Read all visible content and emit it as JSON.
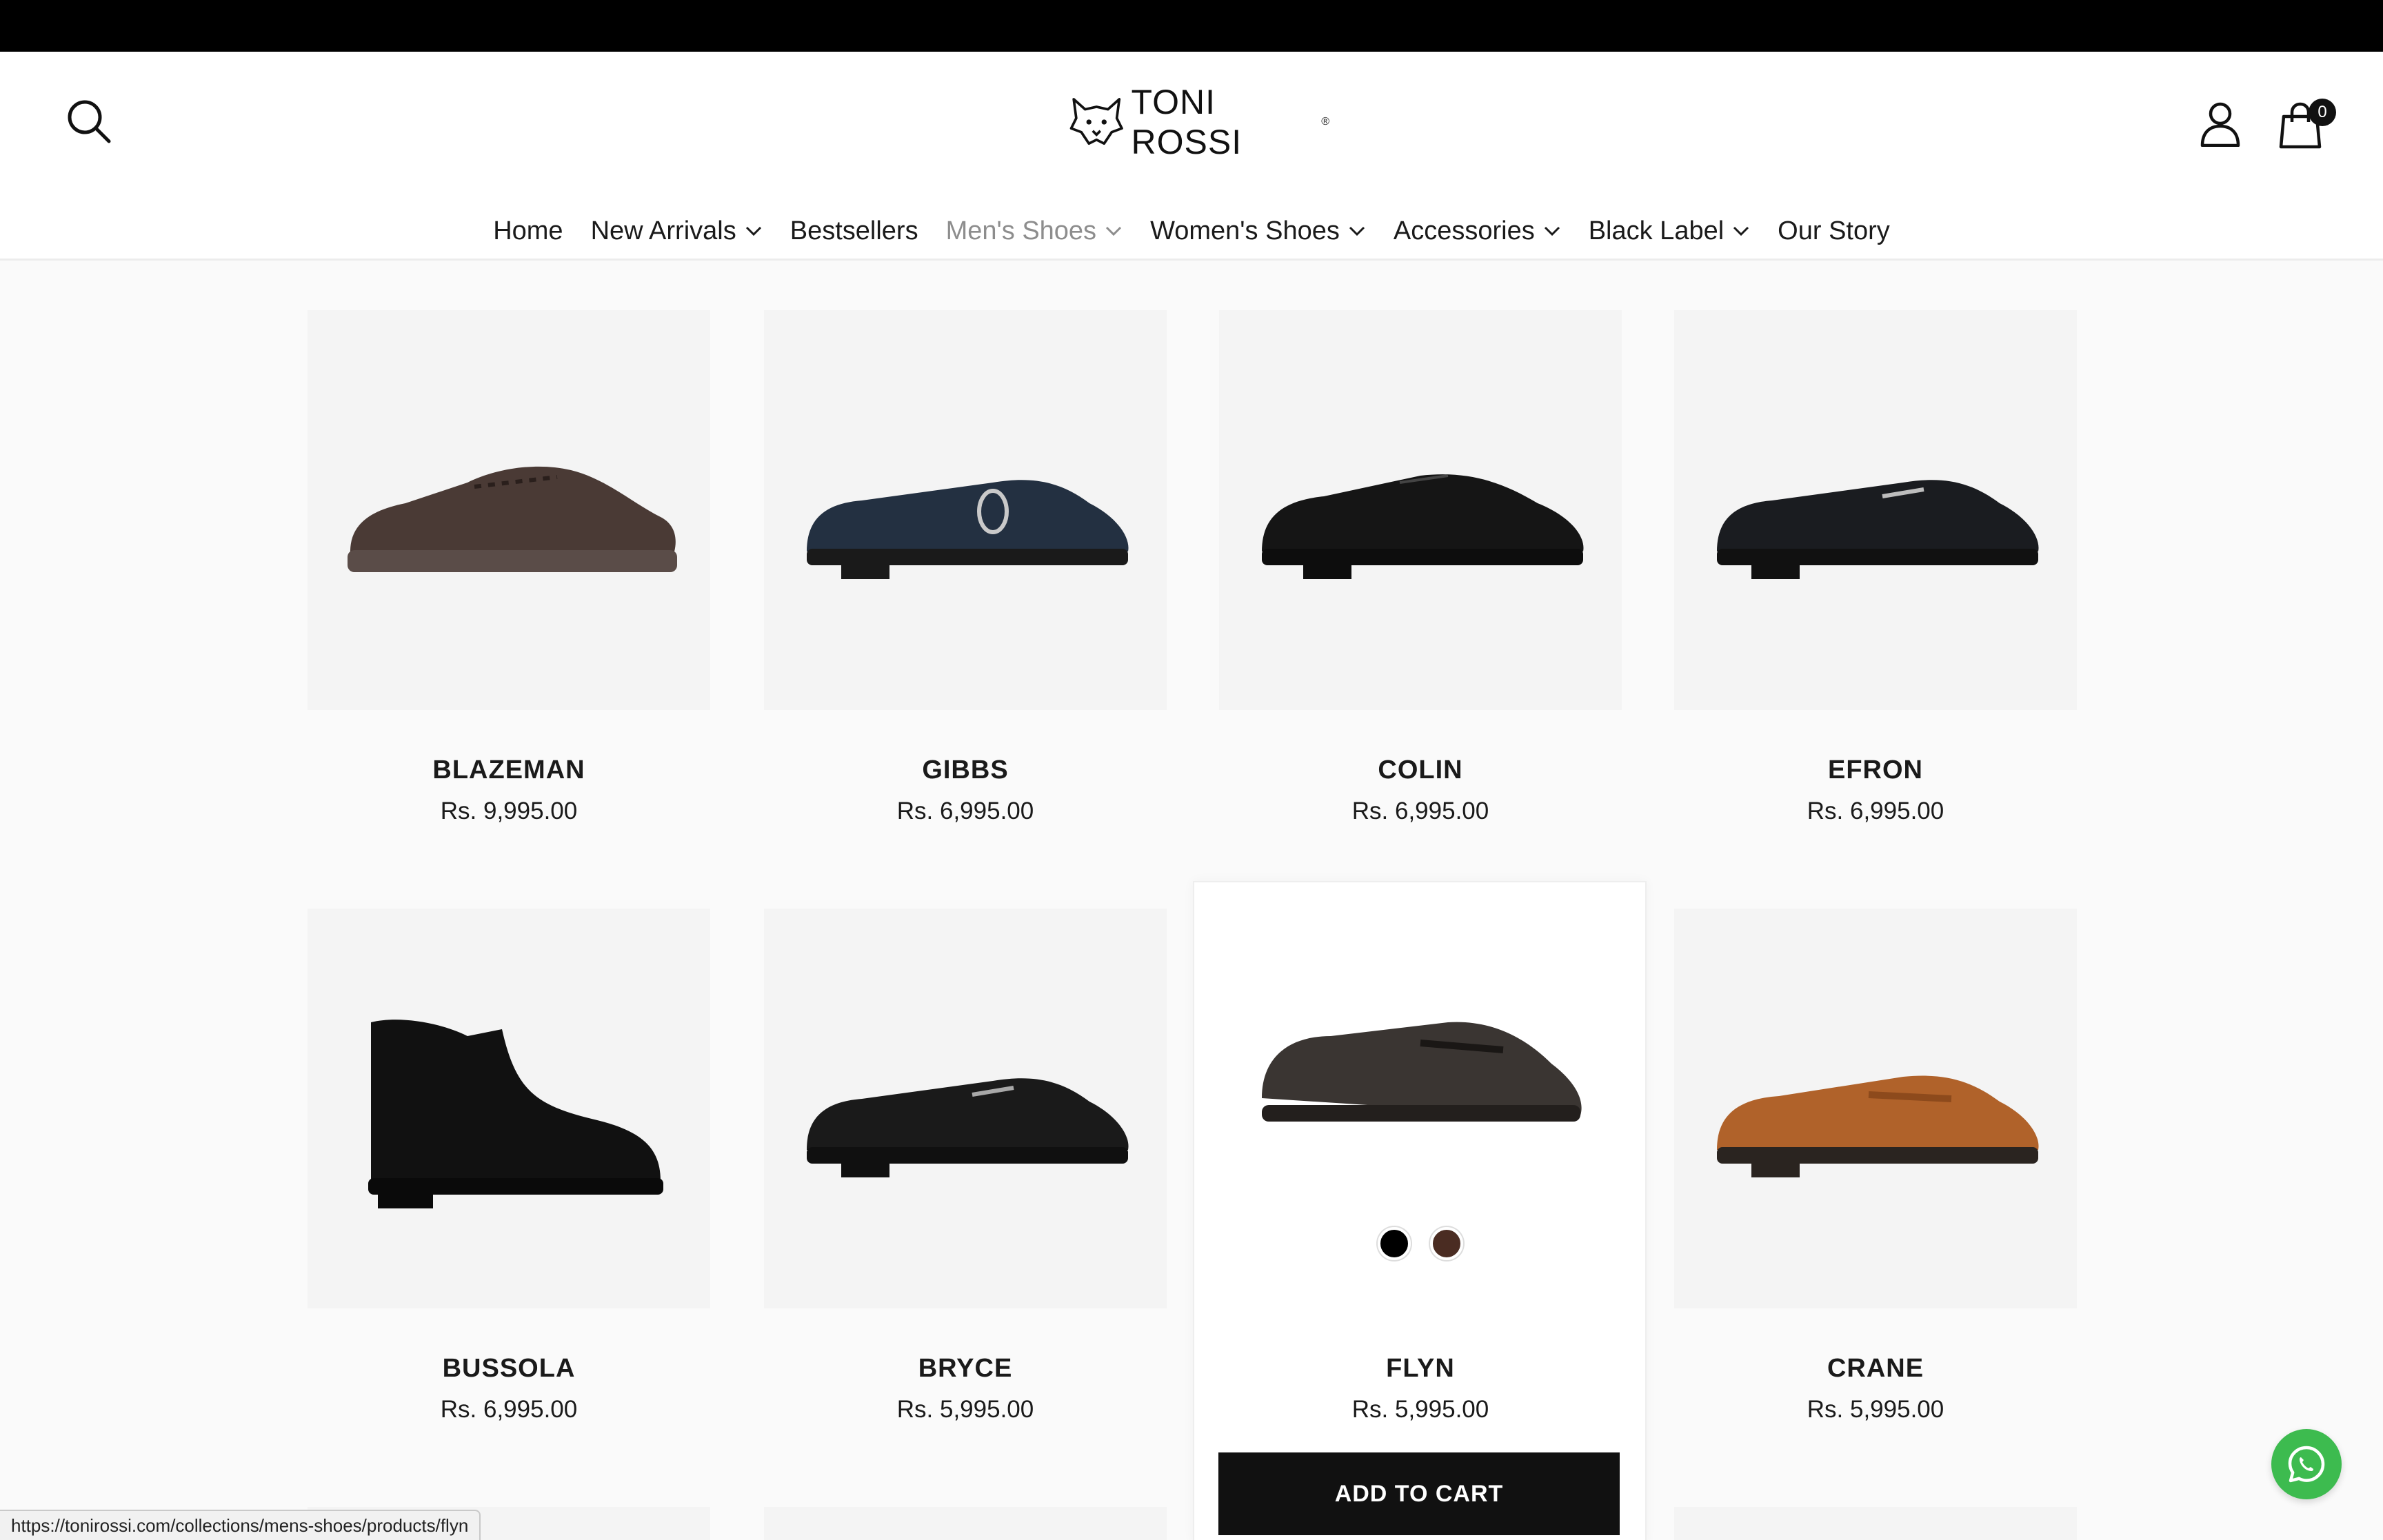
{
  "brand": {
    "name": "TONI ROSSI",
    "reg_mark": "®"
  },
  "header": {
    "cart_count": "0"
  },
  "nav": {
    "items": [
      {
        "label": "Home"
      },
      {
        "label": "New Arrivals"
      },
      {
        "label": "Bestsellers"
      },
      {
        "label": "Men's Shoes"
      },
      {
        "label": "Women's Shoes"
      },
      {
        "label": "Accessories"
      },
      {
        "label": "Black Label"
      },
      {
        "label": "Our Story"
      }
    ]
  },
  "products": [
    {
      "name": "BLAZEMAN",
      "price": "Rs. 9,995.00",
      "color": "#4a3a35",
      "style": "sneaker"
    },
    {
      "name": "GIBBS",
      "price": "Rs. 6,995.00",
      "color": "#233041",
      "style": "loafer-buckle"
    },
    {
      "name": "COLIN",
      "price": "Rs. 6,995.00",
      "color": "#151515",
      "style": "derby"
    },
    {
      "name": "EFRON",
      "price": "Rs. 6,995.00",
      "color": "#1a1c20",
      "style": "loafer-bit"
    },
    {
      "name": "BUSSOLA",
      "price": "Rs. 6,995.00",
      "color": "#111111",
      "style": "chelsea"
    },
    {
      "name": "BRYCE",
      "price": "Rs. 5,995.00",
      "color": "#1a1a1a",
      "style": "loafer-bit"
    },
    {
      "name": "FLYN",
      "price": "Rs. 5,995.00",
      "color": "#3a3532",
      "style": "penny"
    },
    {
      "name": "CRANE",
      "price": "Rs. 5,995.00",
      "color": "#b0622a",
      "style": "penny"
    }
  ],
  "swatches": [
    "#000000",
    "#4a2c22"
  ],
  "add_to_cart_label": "ADD TO CART",
  "status_url": "https://tonirossi.com/collections/mens-shoes/products/flyn"
}
